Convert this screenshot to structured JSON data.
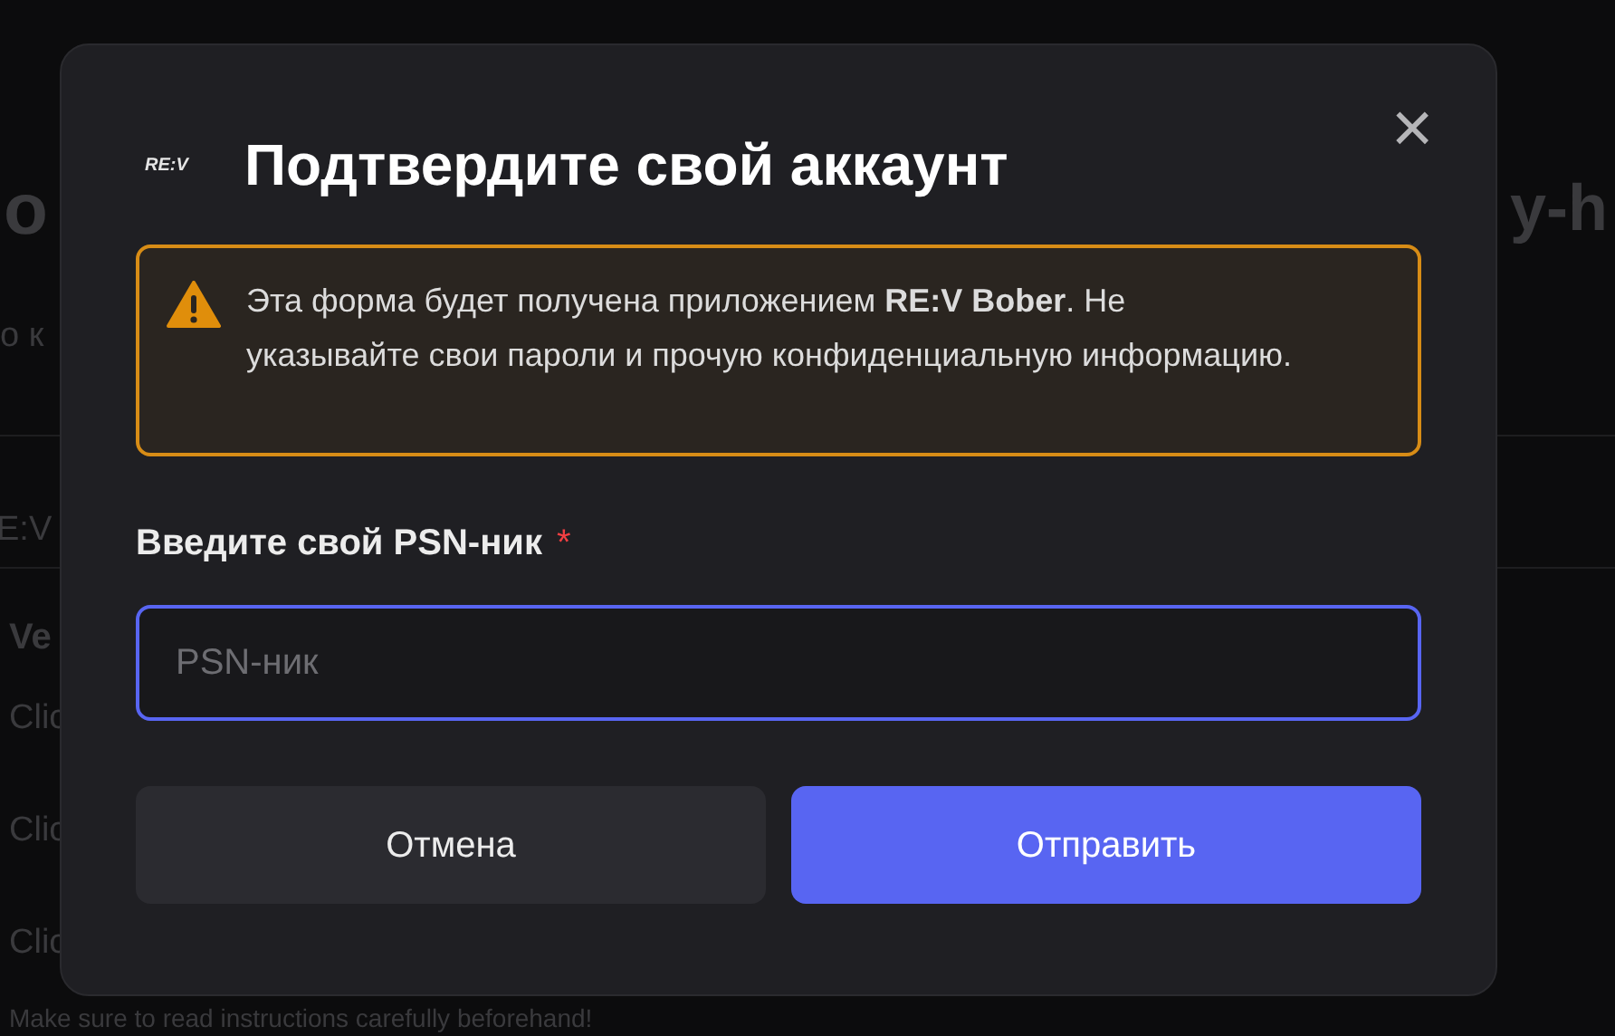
{
  "background": {
    "heading_left": "o",
    "heading_right": "y-h",
    "subtitle": "о к",
    "section": "E:V",
    "bold_item": "Ve",
    "items": [
      "Clic",
      "Clic",
      "Clic"
    ],
    "footer": "Make sure to read instructions carefully beforehand!"
  },
  "dialog": {
    "logo": "RE:V",
    "title": "Подтвердите свой аккаунт",
    "close": "×",
    "warning": "Эта форма будет получена приложением **RE:V Bober**. Не указывайте свои пароли и прочую конфиденциальную информацию.",
    "field": {
      "label": "Введите свой PSN-ник",
      "required": true,
      "required_mark": "*",
      "placeholder": "PSN-ник"
    },
    "buttons": [
      {
        "label": "Отмена",
        "kind": "secondary"
      },
      {
        "label": "Отправить",
        "kind": "primary"
      }
    ]
  }
}
